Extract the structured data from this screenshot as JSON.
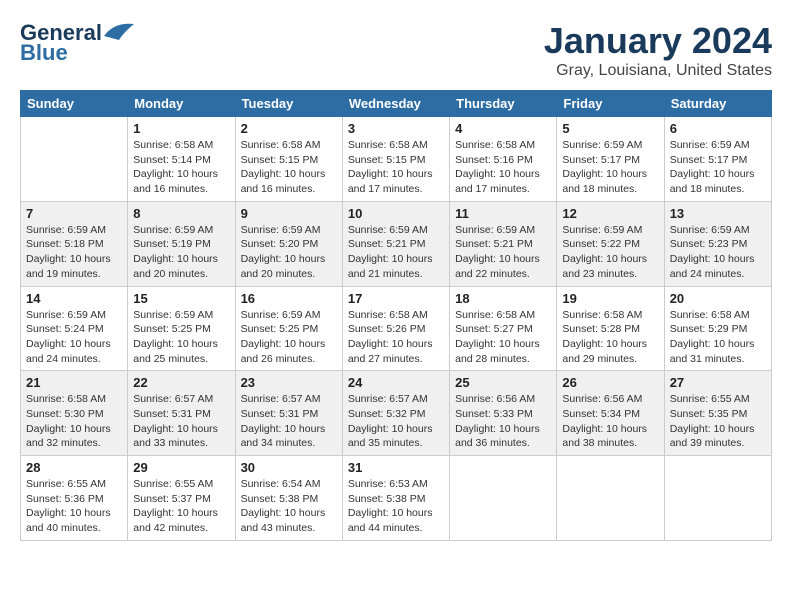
{
  "logo": {
    "line1": "General",
    "line2": "Blue"
  },
  "title": "January 2024",
  "subtitle": "Gray, Louisiana, United States",
  "days_of_week": [
    "Sunday",
    "Monday",
    "Tuesday",
    "Wednesday",
    "Thursday",
    "Friday",
    "Saturday"
  ],
  "weeks": [
    [
      {
        "day": "",
        "info": ""
      },
      {
        "day": "1",
        "info": "Sunrise: 6:58 AM\nSunset: 5:14 PM\nDaylight: 10 hours\nand 16 minutes."
      },
      {
        "day": "2",
        "info": "Sunrise: 6:58 AM\nSunset: 5:15 PM\nDaylight: 10 hours\nand 16 minutes."
      },
      {
        "day": "3",
        "info": "Sunrise: 6:58 AM\nSunset: 5:15 PM\nDaylight: 10 hours\nand 17 minutes."
      },
      {
        "day": "4",
        "info": "Sunrise: 6:58 AM\nSunset: 5:16 PM\nDaylight: 10 hours\nand 17 minutes."
      },
      {
        "day": "5",
        "info": "Sunrise: 6:59 AM\nSunset: 5:17 PM\nDaylight: 10 hours\nand 18 minutes."
      },
      {
        "day": "6",
        "info": "Sunrise: 6:59 AM\nSunset: 5:17 PM\nDaylight: 10 hours\nand 18 minutes."
      }
    ],
    [
      {
        "day": "7",
        "info": "Sunrise: 6:59 AM\nSunset: 5:18 PM\nDaylight: 10 hours\nand 19 minutes."
      },
      {
        "day": "8",
        "info": "Sunrise: 6:59 AM\nSunset: 5:19 PM\nDaylight: 10 hours\nand 20 minutes."
      },
      {
        "day": "9",
        "info": "Sunrise: 6:59 AM\nSunset: 5:20 PM\nDaylight: 10 hours\nand 20 minutes."
      },
      {
        "day": "10",
        "info": "Sunrise: 6:59 AM\nSunset: 5:21 PM\nDaylight: 10 hours\nand 21 minutes."
      },
      {
        "day": "11",
        "info": "Sunrise: 6:59 AM\nSunset: 5:21 PM\nDaylight: 10 hours\nand 22 minutes."
      },
      {
        "day": "12",
        "info": "Sunrise: 6:59 AM\nSunset: 5:22 PM\nDaylight: 10 hours\nand 23 minutes."
      },
      {
        "day": "13",
        "info": "Sunrise: 6:59 AM\nSunset: 5:23 PM\nDaylight: 10 hours\nand 24 minutes."
      }
    ],
    [
      {
        "day": "14",
        "info": "Sunrise: 6:59 AM\nSunset: 5:24 PM\nDaylight: 10 hours\nand 24 minutes."
      },
      {
        "day": "15",
        "info": "Sunrise: 6:59 AM\nSunset: 5:25 PM\nDaylight: 10 hours\nand 25 minutes."
      },
      {
        "day": "16",
        "info": "Sunrise: 6:59 AM\nSunset: 5:25 PM\nDaylight: 10 hours\nand 26 minutes."
      },
      {
        "day": "17",
        "info": "Sunrise: 6:58 AM\nSunset: 5:26 PM\nDaylight: 10 hours\nand 27 minutes."
      },
      {
        "day": "18",
        "info": "Sunrise: 6:58 AM\nSunset: 5:27 PM\nDaylight: 10 hours\nand 28 minutes."
      },
      {
        "day": "19",
        "info": "Sunrise: 6:58 AM\nSunset: 5:28 PM\nDaylight: 10 hours\nand 29 minutes."
      },
      {
        "day": "20",
        "info": "Sunrise: 6:58 AM\nSunset: 5:29 PM\nDaylight: 10 hours\nand 31 minutes."
      }
    ],
    [
      {
        "day": "21",
        "info": "Sunrise: 6:58 AM\nSunset: 5:30 PM\nDaylight: 10 hours\nand 32 minutes."
      },
      {
        "day": "22",
        "info": "Sunrise: 6:57 AM\nSunset: 5:31 PM\nDaylight: 10 hours\nand 33 minutes."
      },
      {
        "day": "23",
        "info": "Sunrise: 6:57 AM\nSunset: 5:31 PM\nDaylight: 10 hours\nand 34 minutes."
      },
      {
        "day": "24",
        "info": "Sunrise: 6:57 AM\nSunset: 5:32 PM\nDaylight: 10 hours\nand 35 minutes."
      },
      {
        "day": "25",
        "info": "Sunrise: 6:56 AM\nSunset: 5:33 PM\nDaylight: 10 hours\nand 36 minutes."
      },
      {
        "day": "26",
        "info": "Sunrise: 6:56 AM\nSunset: 5:34 PM\nDaylight: 10 hours\nand 38 minutes."
      },
      {
        "day": "27",
        "info": "Sunrise: 6:55 AM\nSunset: 5:35 PM\nDaylight: 10 hours\nand 39 minutes."
      }
    ],
    [
      {
        "day": "28",
        "info": "Sunrise: 6:55 AM\nSunset: 5:36 PM\nDaylight: 10 hours\nand 40 minutes."
      },
      {
        "day": "29",
        "info": "Sunrise: 6:55 AM\nSunset: 5:37 PM\nDaylight: 10 hours\nand 42 minutes."
      },
      {
        "day": "30",
        "info": "Sunrise: 6:54 AM\nSunset: 5:38 PM\nDaylight: 10 hours\nand 43 minutes."
      },
      {
        "day": "31",
        "info": "Sunrise: 6:53 AM\nSunset: 5:38 PM\nDaylight: 10 hours\nand 44 minutes."
      },
      {
        "day": "",
        "info": ""
      },
      {
        "day": "",
        "info": ""
      },
      {
        "day": "",
        "info": ""
      }
    ]
  ]
}
